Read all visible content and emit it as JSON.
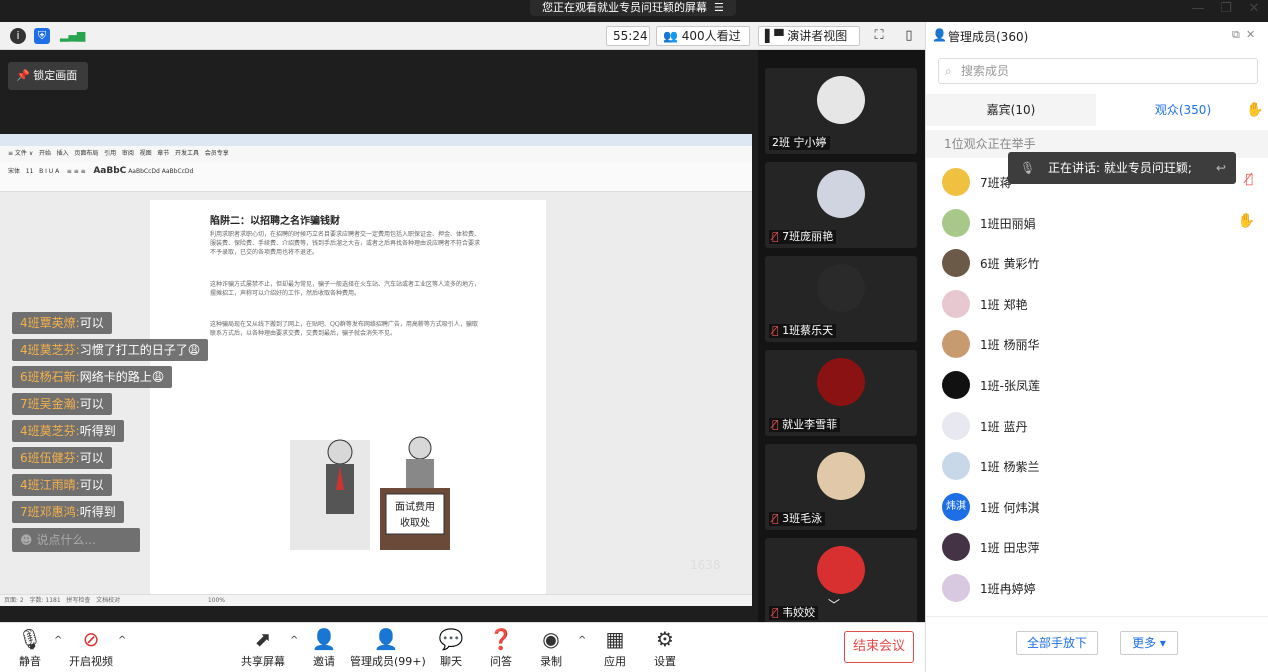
{
  "banner": {
    "text": "您正在观看就业专员问玨颖的屏幕"
  },
  "topbar": {
    "timer": "55:24",
    "viewers": "400人看过",
    "presenter_view": "演讲者视图"
  },
  "stage": {
    "lock_label": "锁定画面",
    "counter": "1638",
    "chat_placeholder": "说点什么...",
    "chat": [
      {
        "who": "4班覃英燎:",
        "text": "可以"
      },
      {
        "who": "4班莫芝芬:",
        "text": "习惯了打工的日子了😩"
      },
      {
        "who": "6班杨石新:",
        "text": "网络卡的路上😩"
      },
      {
        "who": "7班吴金瀚:",
        "text": "可以"
      },
      {
        "who": "4班莫芝芬:",
        "text": "听得到"
      },
      {
        "who": "6班伍健芬:",
        "text": "可以"
      },
      {
        "who": "4班江雨晴:",
        "text": "可以"
      },
      {
        "who": "7班邓惠鸿:",
        "text": "听得到"
      }
    ],
    "doc": {
      "title": "陷阱二：以招聘之名诈骗钱财",
      "p1": "利用求职者求职心切，在招聘的时候巧立名目要求应聘者交一定费用包括入职保证金、押金、体检费、服装费、保险费、手续费、介绍费等，钱到手后溜之大吉，或者之后再找各种理由说应聘者不符合要求不予录取，已交的各项费用也将不退还。",
      "p2": "这种诈骗方式屡禁不止，但却最为常见，骗子一般选择在火车站、汽车站或者工业区等人流多的地方，摆摊招工，声称可以介绍好的工作，然后收取各种费用。",
      "p3": "这种骗局现在又从线下搬到了网上，在贴吧、QQ群等发布网络招聘广告，用高薪等方式吸引人，骗取联系方式后，以各种理由要求交费，交费到最后，骗子就会消失不见。",
      "sign1": "面试费用",
      "sign2": "收取处"
    }
  },
  "video_tiles": [
    {
      "name": "2班 宁小婷",
      "muted": false
    },
    {
      "name": "7班庞丽艳",
      "muted": true
    },
    {
      "name": "1班蔡乐天",
      "muted": true
    },
    {
      "name": "就业李雪菲",
      "muted": true
    },
    {
      "name": "3班毛泳",
      "muted": true
    },
    {
      "name": "韦姣姣",
      "muted": true
    }
  ],
  "bottombar": {
    "mute": "静音",
    "video": "开启视频",
    "share": "共享屏幕",
    "invite": "邀请",
    "members": "管理成员(99+)",
    "chat": "聊天",
    "qa": "问答",
    "record": "录制",
    "apps": "应用",
    "settings": "设置",
    "end": "结束会议"
  },
  "panel": {
    "title": "管理成员(360)",
    "search_placeholder": "搜索成员",
    "tab_guests": "嘉宾(10)",
    "tab_audience": "观众(350)",
    "raise_note": "1位观众正在举手",
    "speaking": "正在讲话: 就业专员问玨颖;",
    "members": [
      {
        "name": "7班蒋",
        "avatar_text": "",
        "color": "#f0c040",
        "hand": false,
        "muted": true
      },
      {
        "name": "1班田丽娟",
        "avatar_text": "",
        "color": "#a8c88a",
        "hand": true,
        "muted": false
      },
      {
        "name": "6班 黄彩竹",
        "avatar_text": "",
        "color": "#6b5a48",
        "hand": false,
        "muted": false
      },
      {
        "name": "1班 郑艳",
        "avatar_text": "",
        "color": "#e8c8d0",
        "hand": false,
        "muted": false
      },
      {
        "name": "1班 杨丽华",
        "avatar_text": "",
        "color": "#c89a70",
        "hand": false,
        "muted": false
      },
      {
        "name": "1班-张凤莲",
        "avatar_text": "",
        "color": "#111111",
        "hand": false,
        "muted": false
      },
      {
        "name": "1班 蓝丹",
        "avatar_text": "",
        "color": "#e8e8f0",
        "hand": false,
        "muted": false
      },
      {
        "name": "1班 杨紫兰",
        "avatar_text": "",
        "color": "#c8d8e8",
        "hand": false,
        "muted": false
      },
      {
        "name": "1班 何炜淇",
        "avatar_text": "炜淇",
        "color": "#1e6fe6",
        "hand": false,
        "muted": false
      },
      {
        "name": "1班 田忠萍",
        "avatar_text": "",
        "color": "#443344",
        "hand": false,
        "muted": false
      },
      {
        "name": "1班冉婷婷",
        "avatar_text": "",
        "color": "#d8c8e0",
        "hand": false,
        "muted": false
      }
    ],
    "all_hands_down": "全部手放下",
    "more": "更多 ▾"
  }
}
